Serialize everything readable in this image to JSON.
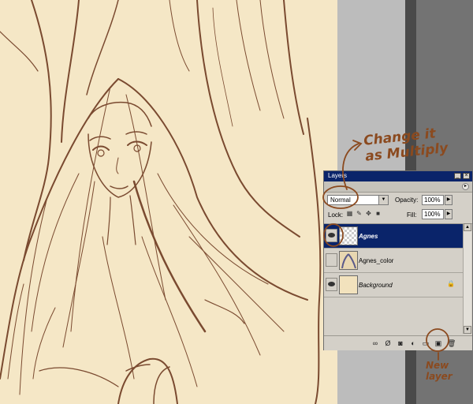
{
  "panel": {
    "title": "Layers",
    "blend_mode": "Normal",
    "opacity_label": "Opacity:",
    "opacity_value": "100%",
    "lock_label": "Lock:",
    "fill_label": "Fill:",
    "fill_value": "100%"
  },
  "layers": [
    {
      "name": "Agnes",
      "visible": true,
      "selected": true,
      "thumb": "transparent"
    },
    {
      "name": "Agnes_color",
      "visible": false,
      "selected": false,
      "thumb": "color"
    },
    {
      "name": "Background",
      "visible": true,
      "selected": false,
      "thumb": "background",
      "locked": true
    }
  ],
  "annotations": {
    "change_line1": "Change it",
    "change_line2": "as Multiply",
    "new_line1": "New",
    "new_line2": "layer"
  },
  "colors": {
    "canvas": "#f5e7c6",
    "ink": "#7a4a30",
    "annotation": "#8b4a1f",
    "selection": "#0a246a",
    "panel": "#d4d0c8"
  }
}
